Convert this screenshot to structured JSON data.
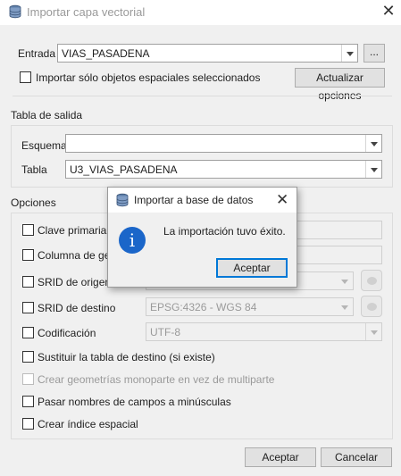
{
  "window": {
    "title": "Importar capa vectorial",
    "icon": "database-icon",
    "close_glyph": "✕"
  },
  "input": {
    "entrada_label": "Entrada",
    "entrada_value": "VIAS_PASADENA",
    "browse_label": "...",
    "selected_only_label": "Importar sólo objetos espaciales seleccionados",
    "update_options_label": "Actualizar opciones"
  },
  "output": {
    "group_label": "Tabla de salida",
    "schema_label": "Esquema",
    "schema_value": "",
    "table_label": "Tabla",
    "table_value": "U3_VIAS_PASADENA"
  },
  "options": {
    "group_label": "Opciones",
    "primary_key_label": "Clave primaria",
    "geom_column_label": "Columna de geo",
    "source_srid_label": "SRID de origen",
    "target_srid_label": "SRID de destino",
    "target_srid_value": "EPSG:4326 - WGS 84",
    "encoding_label": "Codificación",
    "encoding_value": "UTF-8",
    "replace_table_label": "Sustituir la tabla de destino (si existe)",
    "single_part_label": "Crear geometrías monoparte en vez de multiparte",
    "lowercase_label": "Pasar nombres de campos a minúsculas",
    "spatial_index_label": "Crear índice espacial"
  },
  "buttons": {
    "ok": "Aceptar",
    "cancel": "Cancelar"
  },
  "dialog": {
    "title": "Importar a base de datos",
    "close_glyph": "✕",
    "info_glyph": "i",
    "message": "La importación tuvo éxito.",
    "ok": "Aceptar"
  },
  "colors": {
    "accent": "#0078d7",
    "info": "#1b66c9"
  }
}
